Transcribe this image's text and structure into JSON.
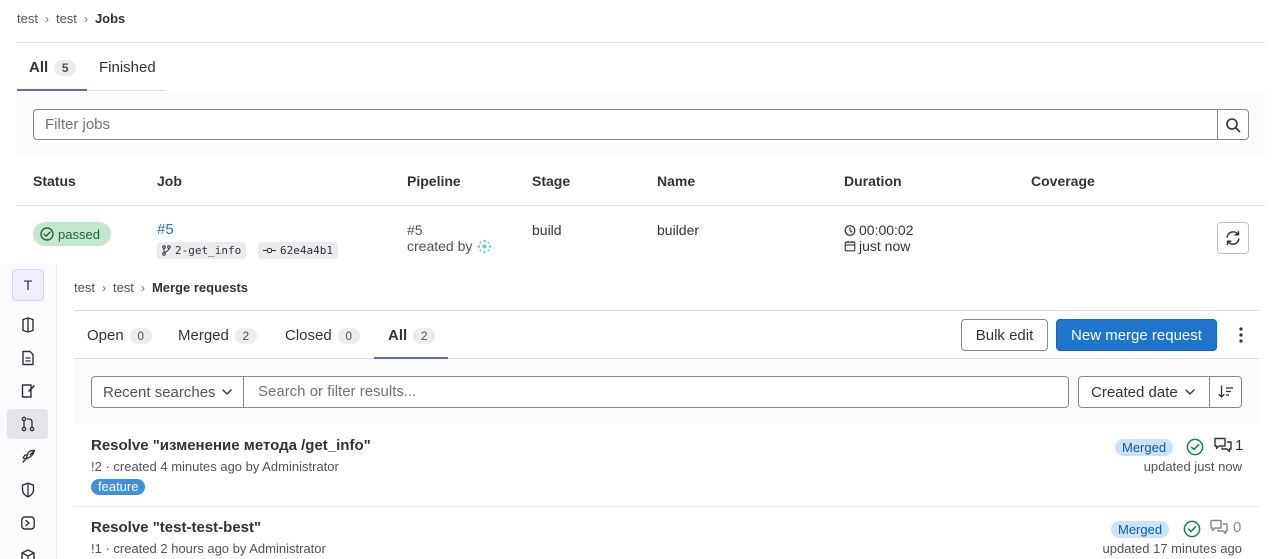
{
  "jobs_page": {
    "breadcrumb": [
      "test",
      "test",
      "Jobs"
    ],
    "tabs": [
      {
        "label": "All",
        "count": "5"
      },
      {
        "label": "Finished"
      }
    ],
    "filter_placeholder": "Filter jobs",
    "columns": [
      "Status",
      "Job",
      "Pipeline",
      "Stage",
      "Name",
      "Duration",
      "Coverage"
    ],
    "rows": [
      {
        "status": "passed",
        "job_id": "#5",
        "branch": "2-get_info",
        "commit": "62e4a4b1",
        "pipeline_id": "#5",
        "pipeline_created_by": "created by",
        "stage": "build",
        "name": "builder",
        "duration": "00:00:02",
        "finished": "just now",
        "coverage": ""
      }
    ]
  },
  "mr_page": {
    "project_avatar": "T",
    "sidebar_icons": [
      "project-icon",
      "issues-icon",
      "issue-board-icon",
      "merge-request-icon",
      "deploy-icon",
      "shield-icon",
      "pipeline-icon",
      "package-icon"
    ],
    "breadcrumb": [
      "test",
      "test",
      "Merge requests"
    ],
    "tabs": [
      {
        "label": "Open",
        "count": "0"
      },
      {
        "label": "Merged",
        "count": "2"
      },
      {
        "label": "Closed",
        "count": "0"
      },
      {
        "label": "All",
        "count": "2"
      }
    ],
    "bulk_edit": "Bulk edit",
    "new_mr": "New merge request",
    "recent_searches": "Recent searches",
    "search_placeholder": "Search or filter results...",
    "sort_label": "Created date",
    "items": [
      {
        "title": "Resolve \"изменение метода /get_info\"",
        "meta": "!2 · created 4 minutes ago by Administrator",
        "label": "feature",
        "state": "Merged",
        "comments": "1",
        "updated": "updated just now"
      },
      {
        "title": "Resolve \"test-test-best\"",
        "meta": "!1 · created 2 hours ago by Administrator",
        "state": "Merged",
        "comments": "0",
        "updated": "updated 17 minutes ago"
      }
    ]
  },
  "colors": {
    "accent": "#1f75cb",
    "tab_underline": "#6466c7",
    "success": "#108548",
    "merged_bg": "#cbe2f9",
    "label_bg": "#428fdc"
  }
}
